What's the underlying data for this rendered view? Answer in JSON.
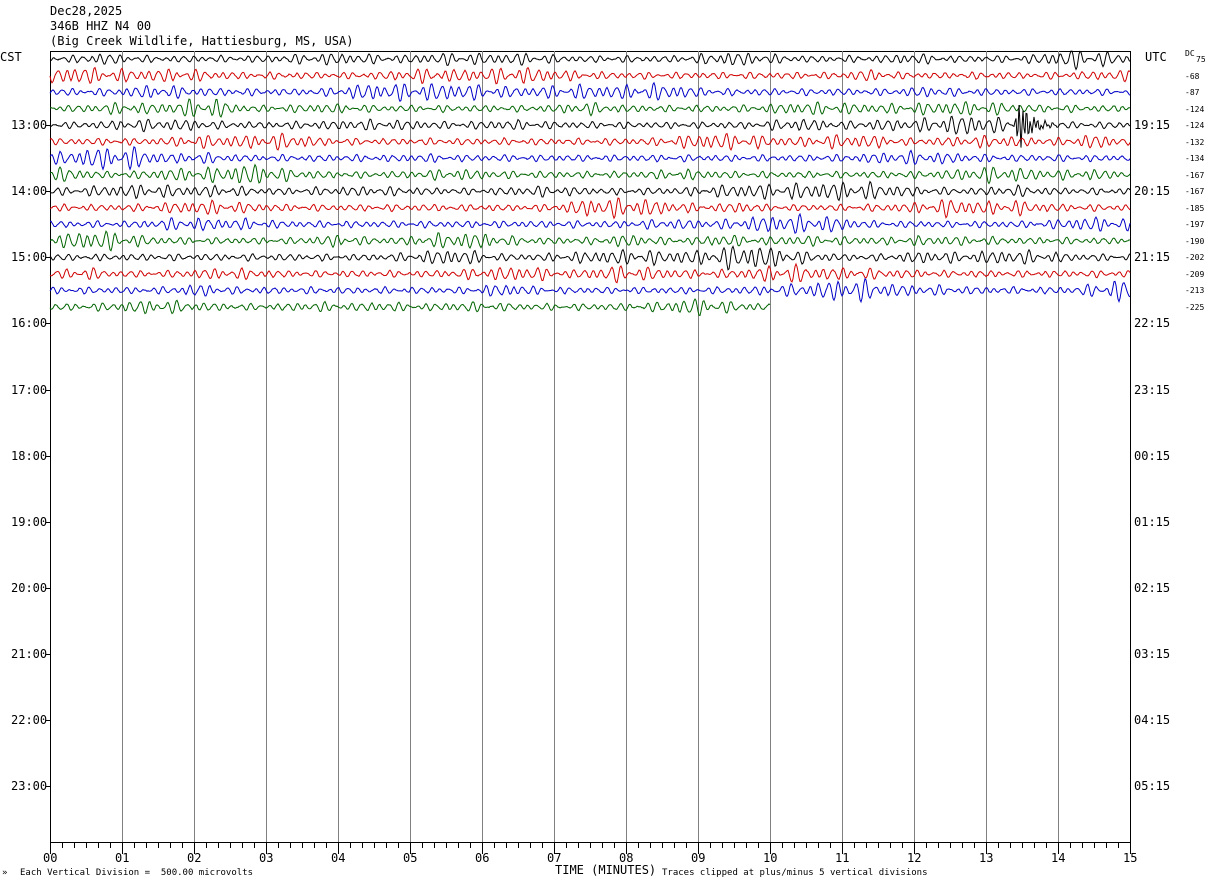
{
  "header": {
    "date": "Dec28,2025",
    "station": "346B HHZ N4 00",
    "location": "(Big Creek Wildlife, Hattiesburg, MS, USA)"
  },
  "axes": {
    "left_title": "CST",
    "right_title": "UTC",
    "dc_title": "DC",
    "xlabel": "TIME (MINUTES)"
  },
  "footer": {
    "scale": "Each Vertical Division =  500.00 microvolts",
    "clip": "Traces clipped at plus/minus 5 vertical divisions"
  },
  "chart_data": {
    "type": "line",
    "title": "",
    "xlim": [
      0,
      15
    ],
    "x_ticks": [
      "00",
      "01",
      "02",
      "03",
      "04",
      "05",
      "06",
      "07",
      "08",
      "09",
      "10",
      "11",
      "12",
      "13",
      "14",
      "15"
    ],
    "rows_per_hour": 4,
    "trace_colors": [
      "#000000",
      "#d00000",
      "#0000c8",
      "#006400"
    ],
    "grid_color": "#808080",
    "left_hour_labels": [
      "13:00",
      "14:00",
      "15:00",
      "16:00",
      "17:00",
      "18:00",
      "19:00",
      "20:00",
      "21:00",
      "22:00",
      "23:00"
    ],
    "right_hour_labels": [
      "19:15",
      "20:15",
      "21:15",
      "22:15",
      "23:15",
      "00:15",
      "01:15",
      "02:15",
      "03:15",
      "04:15",
      "05:15"
    ],
    "dc_offsets": [
      "75",
      "-68",
      "-87",
      "-124",
      "-124",
      "-132",
      "-134",
      "-167",
      "-167",
      "-185",
      "-197",
      "-190",
      "-202",
      "-209",
      "-213",
      "-225"
    ],
    "traces_recorded": 16,
    "last_trace_minutes": 10.0,
    "event": {
      "trace_index": 4,
      "minute": 13.5,
      "duration_minutes": 0.6
    }
  }
}
